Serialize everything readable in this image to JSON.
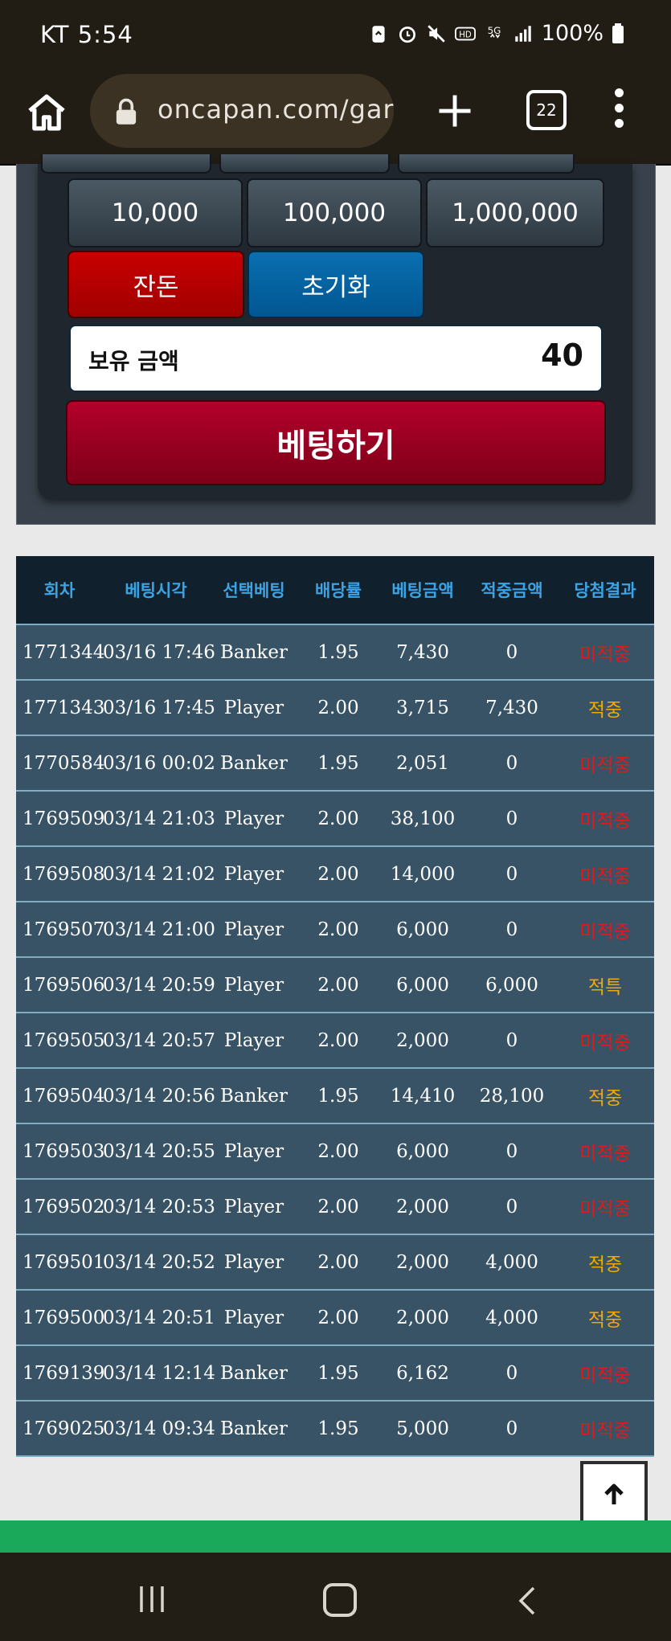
{
  "status_bar": {
    "carrier_time": "KT 5:54",
    "battery": "100%"
  },
  "browser": {
    "url": "oncapan.com/gar",
    "tab_count": "22"
  },
  "bet_panel": {
    "chips": [
      "10,000",
      "100,000",
      "1,000,000"
    ],
    "change_label": "잔돈",
    "reset_label": "초기화",
    "balance_label": "보유 금액",
    "balance_value": "40",
    "bet_button_label": "베팅하기"
  },
  "history": {
    "headers": [
      "회차",
      "베팅시각",
      "선택베팅",
      "배당률",
      "베팅금액",
      "적중금액",
      "당첨결과"
    ],
    "rows": [
      {
        "round": "1771344",
        "time": "03/16 17:46",
        "pick": "Banker",
        "odds": "1.95",
        "bet": "7,430",
        "win": "0",
        "result": "미적중"
      },
      {
        "round": "1771343",
        "time": "03/16 17:45",
        "pick": "Player",
        "odds": "2.00",
        "bet": "3,715",
        "win": "7,430",
        "result": "적중"
      },
      {
        "round": "1770584",
        "time": "03/16 00:02",
        "pick": "Banker",
        "odds": "1.95",
        "bet": "2,051",
        "win": "0",
        "result": "미적중"
      },
      {
        "round": "1769509",
        "time": "03/14 21:03",
        "pick": "Player",
        "odds": "2.00",
        "bet": "38,100",
        "win": "0",
        "result": "미적중"
      },
      {
        "round": "1769508",
        "time": "03/14 21:02",
        "pick": "Player",
        "odds": "2.00",
        "bet": "14,000",
        "win": "0",
        "result": "미적중"
      },
      {
        "round": "1769507",
        "time": "03/14 21:00",
        "pick": "Player",
        "odds": "2.00",
        "bet": "6,000",
        "win": "0",
        "result": "미적중"
      },
      {
        "round": "1769506",
        "time": "03/14 20:59",
        "pick": "Player",
        "odds": "2.00",
        "bet": "6,000",
        "win": "6,000",
        "result": "적특"
      },
      {
        "round": "1769505",
        "time": "03/14 20:57",
        "pick": "Player",
        "odds": "2.00",
        "bet": "2,000",
        "win": "0",
        "result": "미적중"
      },
      {
        "round": "1769504",
        "time": "03/14 20:56",
        "pick": "Banker",
        "odds": "1.95",
        "bet": "14,410",
        "win": "28,100",
        "result": "적중"
      },
      {
        "round": "1769503",
        "time": "03/14 20:55",
        "pick": "Player",
        "odds": "2.00",
        "bet": "6,000",
        "win": "0",
        "result": "미적중"
      },
      {
        "round": "1769502",
        "time": "03/14 20:53",
        "pick": "Player",
        "odds": "2.00",
        "bet": "2,000",
        "win": "0",
        "result": "미적중"
      },
      {
        "round": "1769501",
        "time": "03/14 20:52",
        "pick": "Player",
        "odds": "2.00",
        "bet": "2,000",
        "win": "4,000",
        "result": "적중"
      },
      {
        "round": "1769500",
        "time": "03/14 20:51",
        "pick": "Player",
        "odds": "2.00",
        "bet": "2,000",
        "win": "4,000",
        "result": "적중"
      },
      {
        "round": "1769139",
        "time": "03/14 12:14",
        "pick": "Banker",
        "odds": "1.95",
        "bet": "6,162",
        "win": "0",
        "result": "미적중"
      },
      {
        "round": "1769025",
        "time": "03/14 09:34",
        "pick": "Banker",
        "odds": "1.95",
        "bet": "5,000",
        "win": "0",
        "result": "미적중"
      }
    ]
  },
  "colors": {
    "win": "#f2a900",
    "lose": "#e01a1a",
    "header_text": "#3aa4e6"
  },
  "icons": {
    "scroll_top": "arrow-up-icon"
  }
}
